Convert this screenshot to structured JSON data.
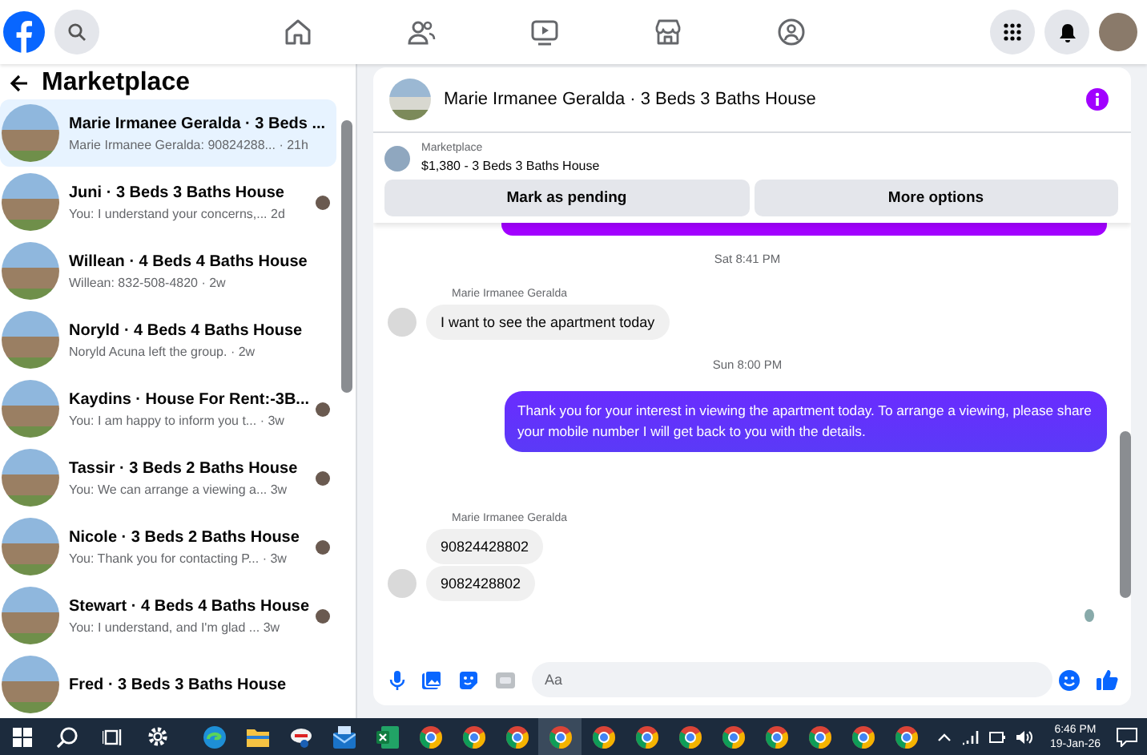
{
  "sidebar": {
    "title": "Marketplace",
    "conversations": [
      {
        "title": "Marie Irmanee Geralda · 3 Beds ...",
        "subtitle": "Marie Irmanee Geralda: 90824288... · 21h",
        "selected": true,
        "seen": false
      },
      {
        "title": "Juni · 3 Beds 3 Baths House",
        "subtitle": "You: I understand your concerns,... 2d",
        "selected": false,
        "seen": true
      },
      {
        "title": "Willean · 4 Beds 4 Baths House",
        "subtitle": "Willean: 832-508-4820 · 2w",
        "selected": false,
        "seen": false
      },
      {
        "title": "Noryld · 4 Beds 4 Baths House",
        "subtitle": "Noryld Acuna left the group. · 2w",
        "selected": false,
        "seen": false
      },
      {
        "title": "Kaydins · House For Rent:-3B...",
        "subtitle": "You: I am happy to inform you t... · 3w",
        "selected": false,
        "seen": true
      },
      {
        "title": "Tassir · 3 Beds 2 Baths House",
        "subtitle": "You: We can arrange a viewing a... 3w",
        "selected": false,
        "seen": true
      },
      {
        "title": "Nicole · 3 Beds 2 Baths House",
        "subtitle": "You: Thank you for contacting P... · 3w",
        "selected": false,
        "seen": true
      },
      {
        "title": "Stewart · 4 Beds 4 Baths House",
        "subtitle": "You: I understand, and I'm glad ...  3w",
        "selected": false,
        "seen": true
      },
      {
        "title": "Fred · 3 Beds 3 Baths House",
        "selected": false,
        "seen": false
      }
    ]
  },
  "chat": {
    "title": "Marie Irmanee Geralda · 3 Beds 3 Baths House",
    "listing": {
      "label": "Marketplace",
      "text": "$1,380 - 3 Beds 3 Baths House"
    },
    "actions": [
      "Mark as pending",
      "More options"
    ],
    "messages": [
      {
        "kind": "cut"
      },
      {
        "kind": "time",
        "text": "Sat 8:41 PM"
      },
      {
        "kind": "sender",
        "text": "Marie Irmanee Geralda"
      },
      {
        "kind": "incoming",
        "text": "I want to see the apartment today",
        "avatar": true
      },
      {
        "kind": "time",
        "text": "Sun 8:00 PM"
      },
      {
        "kind": "outgoing",
        "text": "Thank you for your interest in viewing the apartment today. To arrange a viewing, please share your mobile number  I will get back to you with the details."
      },
      {
        "kind": "sender",
        "text": "Marie Irmanee Geralda"
      },
      {
        "kind": "incoming",
        "text": "90824428802",
        "avatar": false
      },
      {
        "kind": "incoming",
        "text": "9082428802",
        "avatar": true
      }
    ],
    "composer": {
      "placeholder": "Aa"
    }
  },
  "taskbar": {
    "apps": [
      {
        "kind": "edge",
        "selected": false
      },
      {
        "kind": "folder",
        "selected": false
      },
      {
        "kind": "app",
        "selected": false
      },
      {
        "kind": "mail",
        "selected": false
      },
      {
        "kind": "excel",
        "selected": false
      },
      {
        "kind": "chrome",
        "selected": false
      },
      {
        "kind": "chrome",
        "selected": false
      },
      {
        "kind": "chrome",
        "selected": false
      },
      {
        "kind": "chrome",
        "selected": true
      },
      {
        "kind": "chrome",
        "selected": false
      },
      {
        "kind": "chrome",
        "selected": false
      },
      {
        "kind": "chrome",
        "selected": false
      },
      {
        "kind": "chrome",
        "selected": false
      },
      {
        "kind": "chrome",
        "selected": false
      },
      {
        "kind": "chrome",
        "selected": false
      },
      {
        "kind": "chrome",
        "selected": false
      },
      {
        "kind": "chrome",
        "selected": false
      }
    ],
    "time": "6:46 PM",
    "date": "19-Jan-26"
  }
}
